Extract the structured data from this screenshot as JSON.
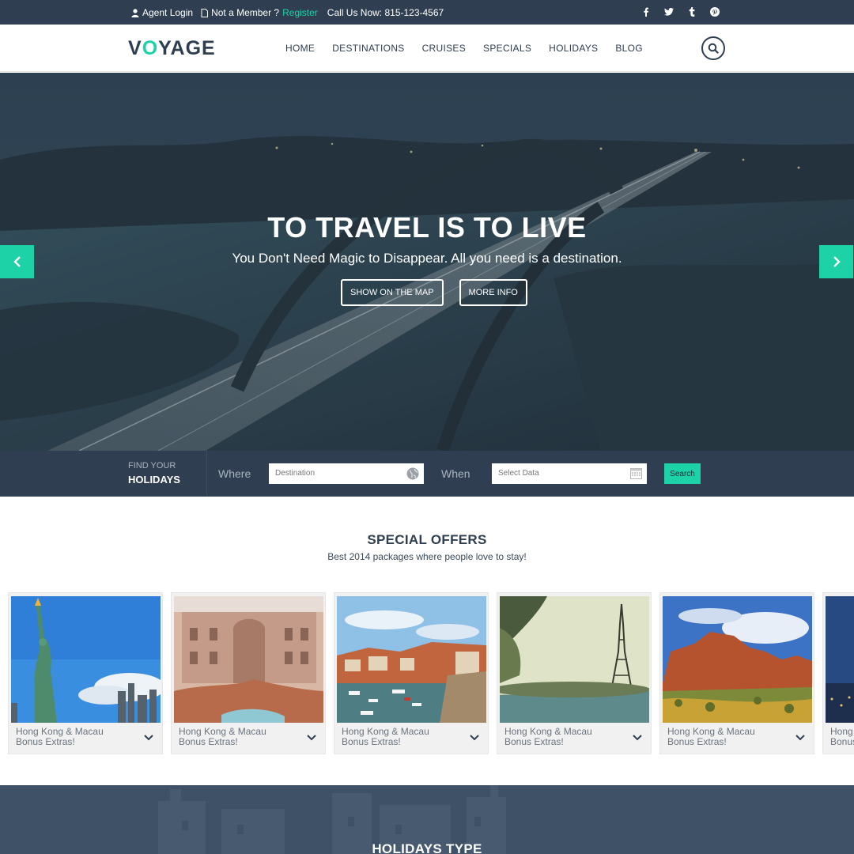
{
  "topbar": {
    "agent_login": "Agent Login",
    "not_member": "Not a Member ?",
    "register": "Register",
    "call_us": "Call Us Now: 815-123-4567",
    "social": [
      "facebook-icon",
      "twitter-icon",
      "tumblr-icon",
      "pinterest-icon"
    ]
  },
  "header": {
    "logo_pre": "V",
    "logo_o": "O",
    "logo_post": "YAGE",
    "nav": [
      "HOME",
      "DESTINATIONS",
      "CRUISES",
      "SPECIALS",
      "HOLIDAYS",
      "BLOG"
    ]
  },
  "hero": {
    "title": "TO TRAVEL IS TO LIVE",
    "subtitle": "You Don't Need Magic to Disappear. All you need is a destination.",
    "btn_map": "SHOW ON THE MAP",
    "btn_info": "MORE INFO"
  },
  "search": {
    "find_your": "FIND YOUR",
    "holidays": "HOLIDAYS",
    "where_label": "Where",
    "destination_placeholder": "Destination",
    "when_label": "When",
    "date_placeholder": "Select Data",
    "search_btn": "Search"
  },
  "offers": {
    "title": "SPECIAL OFFERS",
    "subtitle": "Best 2014 packages where people love to stay!",
    "cards": [
      {
        "line1": "Hong Kong & Macau",
        "line2": "Bonus Extras!"
      },
      {
        "line1": "Hong Kong & Macau",
        "line2": "Bonus Extras!"
      },
      {
        "line1": "Hong Kong & Macau",
        "line2": "Bonus Extras!"
      },
      {
        "line1": "Hong Kong & Macau",
        "line2": "Bonus Extras!"
      },
      {
        "line1": "Hong Kong & Macau",
        "line2": "Bonus Extras!"
      },
      {
        "line1": "Hong Kong",
        "line2": "Bonus"
      }
    ]
  },
  "holidays_type": {
    "title": "HOLIDAYS TYPE"
  },
  "colors": {
    "accent": "#1ed2a8",
    "navy": "#2f3e50"
  }
}
